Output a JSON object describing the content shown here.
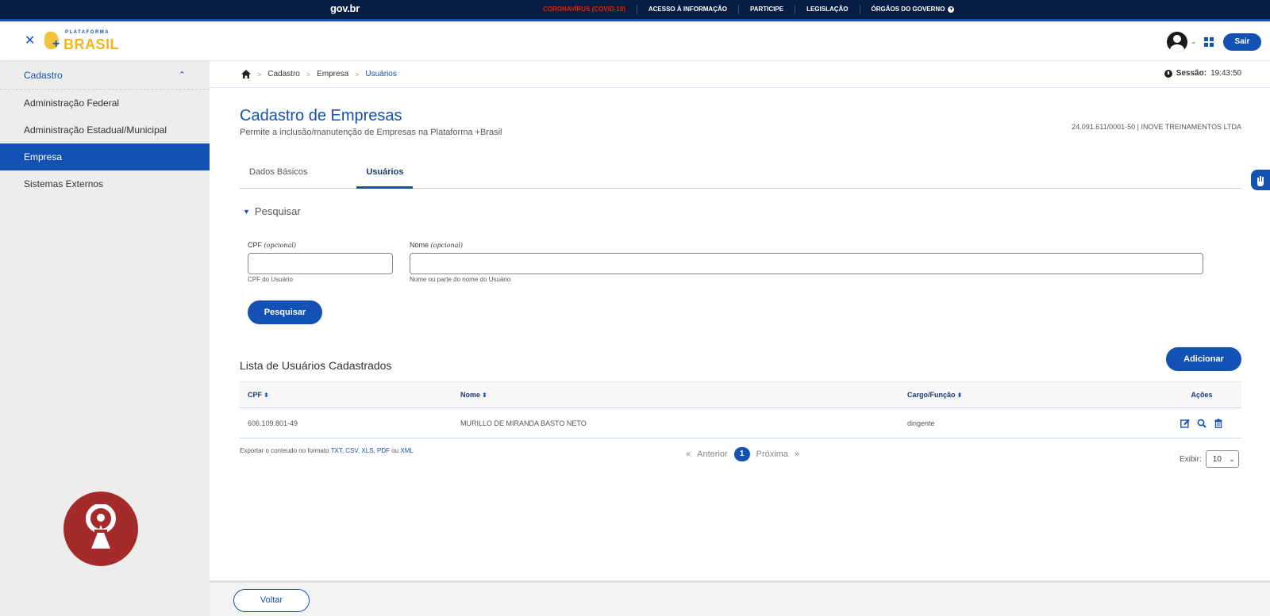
{
  "govbar": {
    "logo": "gov.br",
    "links": [
      "CORONAVÍRUS (COVID-19)",
      "ACESSO À INFORMAÇÃO",
      "PARTICIPE",
      "LEGISLAÇÃO",
      "ÓRGÃOS DO GOVERNO"
    ]
  },
  "header": {
    "brand_top": "PLATAFORMA",
    "brand_plus": "+",
    "brand_main": "BRASIL",
    "logout_label": "Sair"
  },
  "sidebar": {
    "section": "Cadastro",
    "items": [
      {
        "label": "Administração Federal"
      },
      {
        "label": "Administração Estadual/Municipal"
      },
      {
        "label": "Empresa"
      },
      {
        "label": "Sistemas Externos"
      }
    ],
    "active_index": 2
  },
  "breadcrumb": {
    "items": [
      "Cadastro",
      "Empresa",
      "Usuários"
    ]
  },
  "session": {
    "label": "Sessão:",
    "time": "19:43:50"
  },
  "page": {
    "title": "Cadastro de Empresas",
    "subtitle": "Permite a inclusão/manutenção de Empresas na Plataforma +Brasil",
    "company": "24.091.611/0001-50 | INOVE TREINAMENTOS LTDA"
  },
  "tabs": [
    {
      "label": "Dados Básicos",
      "active": false
    },
    {
      "label": "Usuários",
      "active": true
    }
  ],
  "search": {
    "toggle_label": "Pesquisar",
    "cpf": {
      "label": "CPF",
      "optional": "(opcional)",
      "value": "",
      "help": "CPF do Usuário"
    },
    "nome": {
      "label": "Nome",
      "optional": "(opcional)",
      "value": "",
      "help": "Nome ou parte do nome do Usuário"
    },
    "button_label": "Pesquisar"
  },
  "list": {
    "title": "Lista de Usuários Cadastrados",
    "add_label": "Adicionar",
    "columns": [
      "CPF",
      "Nome",
      "Cargo/Função",
      "Ações"
    ],
    "rows": [
      {
        "cpf": "606.109.801-49",
        "nome": "MURILLO DE MIRANDA BASTO NETO",
        "cargo": "dirigente"
      }
    ],
    "export_prefix": "Exportar o conteudo no formato",
    "export_formats": "TXT, CSV, XLS, PDF",
    "export_or": "ou",
    "export_last": "XML",
    "pagination": {
      "prev": "Anterior",
      "current": "1",
      "next": "Próxima"
    },
    "show_label": "Exibir:",
    "page_size": "10"
  },
  "footer": {
    "back_label": "Voltar"
  },
  "colors": {
    "primary": "#1351b4",
    "govbar": "#071d41",
    "covid": "#e52207",
    "logo_red": "#a52a2a"
  }
}
